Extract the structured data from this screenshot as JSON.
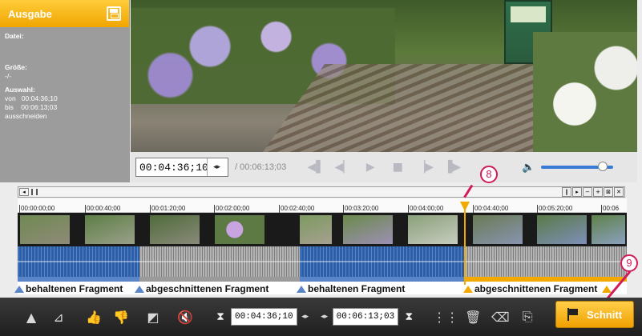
{
  "output_panel": {
    "title": "Ausgabe",
    "datei_label": "Datei:",
    "datei_value": "",
    "groesse_label": "Größe:",
    "groesse_value": "-/-",
    "auswahl_label": "Auswahl:",
    "auswahl_von": "von   00:04:36;10",
    "auswahl_bis": "bis    00:06:13;03",
    "auswahl_action": "ausschneiden",
    "save_icon": "save-icon"
  },
  "player": {
    "current_timecode": "00:04:36;10",
    "total_timecode": "/ 00:06:13;03",
    "volume_level": 0.85
  },
  "timeline": {
    "ruler_labels": [
      "00:00:00;00",
      "00:00:40;00",
      "00:01:20;00",
      "00:02:00;00",
      "00:02:40;00",
      "00:03:20;00",
      "00:04:00;00",
      "00:04:40;00",
      "00:05:20;00",
      "00:06"
    ],
    "marker_timecode": "00:04:36;10"
  },
  "fragments": [
    {
      "label": "behaltenen Fragment",
      "type": "keep"
    },
    {
      "label": "abgeschnittenen Fragment",
      "type": "cut"
    },
    {
      "label": "behaltenen Fragment",
      "type": "keep"
    },
    {
      "label": "abgeschnittenen Fragment",
      "type": "cut"
    }
  ],
  "range": {
    "start": "00:04:36;10",
    "end": "00:06:13;03"
  },
  "cut_button": {
    "label": "Schnitt"
  },
  "annotations": {
    "callout_8": "8",
    "callout_9": "9"
  },
  "colors": {
    "accent": "#f2a900",
    "keep": "#5a86c9",
    "annotation": "#d11a5b"
  }
}
